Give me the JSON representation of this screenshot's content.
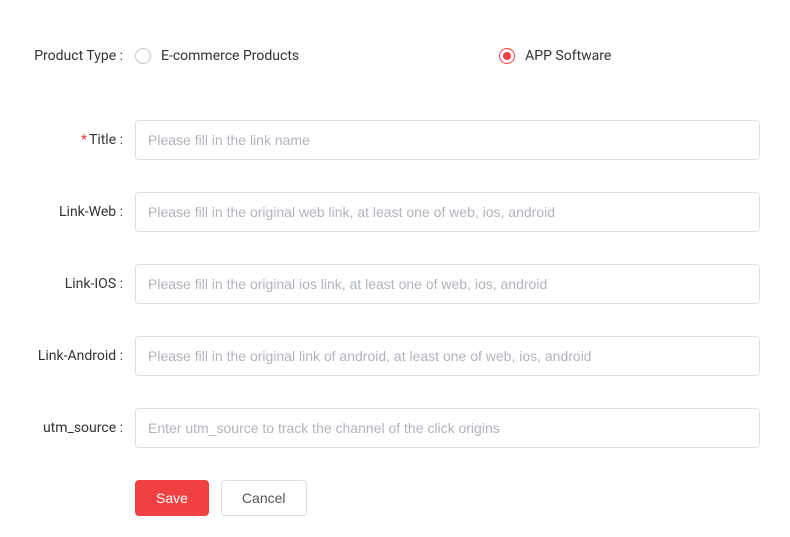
{
  "productType": {
    "label": "Product Type :",
    "options": [
      {
        "label": "E-commerce Products",
        "selected": false
      },
      {
        "label": "APP Software",
        "selected": true
      }
    ]
  },
  "fields": {
    "title": {
      "label": "Title :",
      "required": true,
      "placeholder": "Please fill in the link name",
      "value": ""
    },
    "linkWeb": {
      "label": "Link-Web :",
      "required": false,
      "placeholder": "Please fill in the original web link, at least one of web, ios, android",
      "value": ""
    },
    "linkIos": {
      "label": "Link-IOS :",
      "required": false,
      "placeholder": "Please fill in the original ios link, at least one of web, ios, android",
      "value": ""
    },
    "linkAndroid": {
      "label": "Link-Android :",
      "required": false,
      "placeholder": "Please fill in the original link of android, at least one of web, ios, android",
      "value": ""
    },
    "utmSource": {
      "label": "utm_source :",
      "required": false,
      "placeholder": "Enter utm_source to track the channel of the click origins",
      "value": ""
    }
  },
  "buttons": {
    "save": "Save",
    "cancel": "Cancel"
  }
}
